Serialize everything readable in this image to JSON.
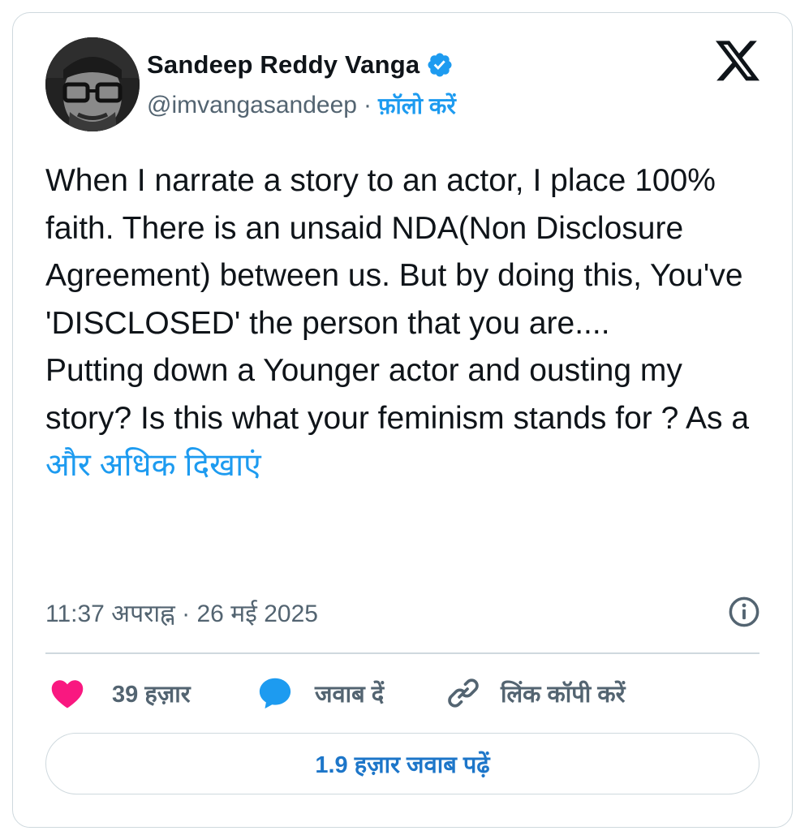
{
  "author": {
    "name": "Sandeep Reddy Vanga",
    "handle": "@imvangasandeep",
    "separator": "·",
    "follow_label": "फ़ॉलो करें"
  },
  "tweet": {
    "text": "When I narrate a story to an actor, I place 100% faith. There is an unsaid NDA(Non Disclosure Agreement) between us. But by doing this, You've 'DISCLOSED' the person that you are....\nPutting down a Younger actor and ousting my story?  Is this what your feminism stands for ? As a ",
    "show_more_label": "और अधिक दिखाएं",
    "timestamp": "11:37 अपराह्न · 26 मई 2025"
  },
  "actions": {
    "like_count": "39 हज़ार",
    "reply_label": "जवाब दें",
    "copy_link_label": "लिंक कॉपी करें"
  },
  "read_replies_label": "1.9 हज़ार जवाब पढ़ें",
  "icons": {
    "verified": "verified-badge-icon",
    "x_logo": "x-logo-icon",
    "info": "info-icon",
    "like": "heart-icon",
    "reply": "speech-bubble-icon",
    "copy": "link-icon"
  },
  "colors": {
    "accent": "#1d9bf0",
    "heart": "#f91880",
    "text": "#0f1419",
    "muted": "#536471",
    "border": "#cfd9de"
  }
}
